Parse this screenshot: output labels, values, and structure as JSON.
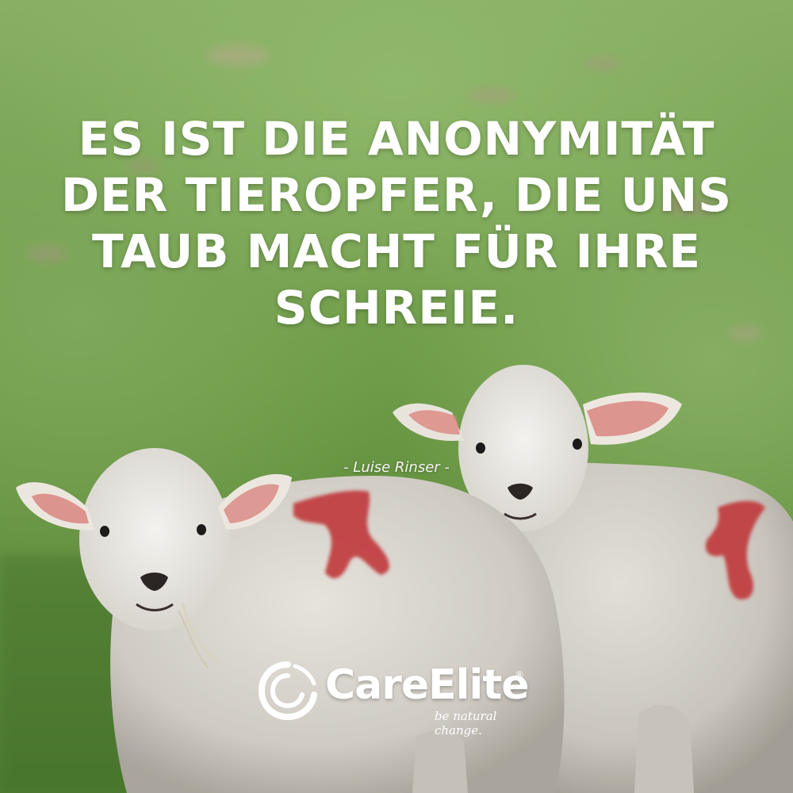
{
  "quote": {
    "text": "Es ist die Anonymität der Tieropfer, die uns taub macht für ihre Schreie.",
    "author": "- Luise Rinser -"
  },
  "brand": {
    "name": "CareElite",
    "registered": "®",
    "tagline": "be natural change."
  },
  "colors": {
    "text": "#ffffff",
    "grass": "#6f9a4a",
    "wool": "#d9d6cf",
    "paint_mark": "#c0393b",
    "ear_inner": "#d98680"
  },
  "icons": {
    "logo": "careelite-swirl-logo-icon"
  }
}
